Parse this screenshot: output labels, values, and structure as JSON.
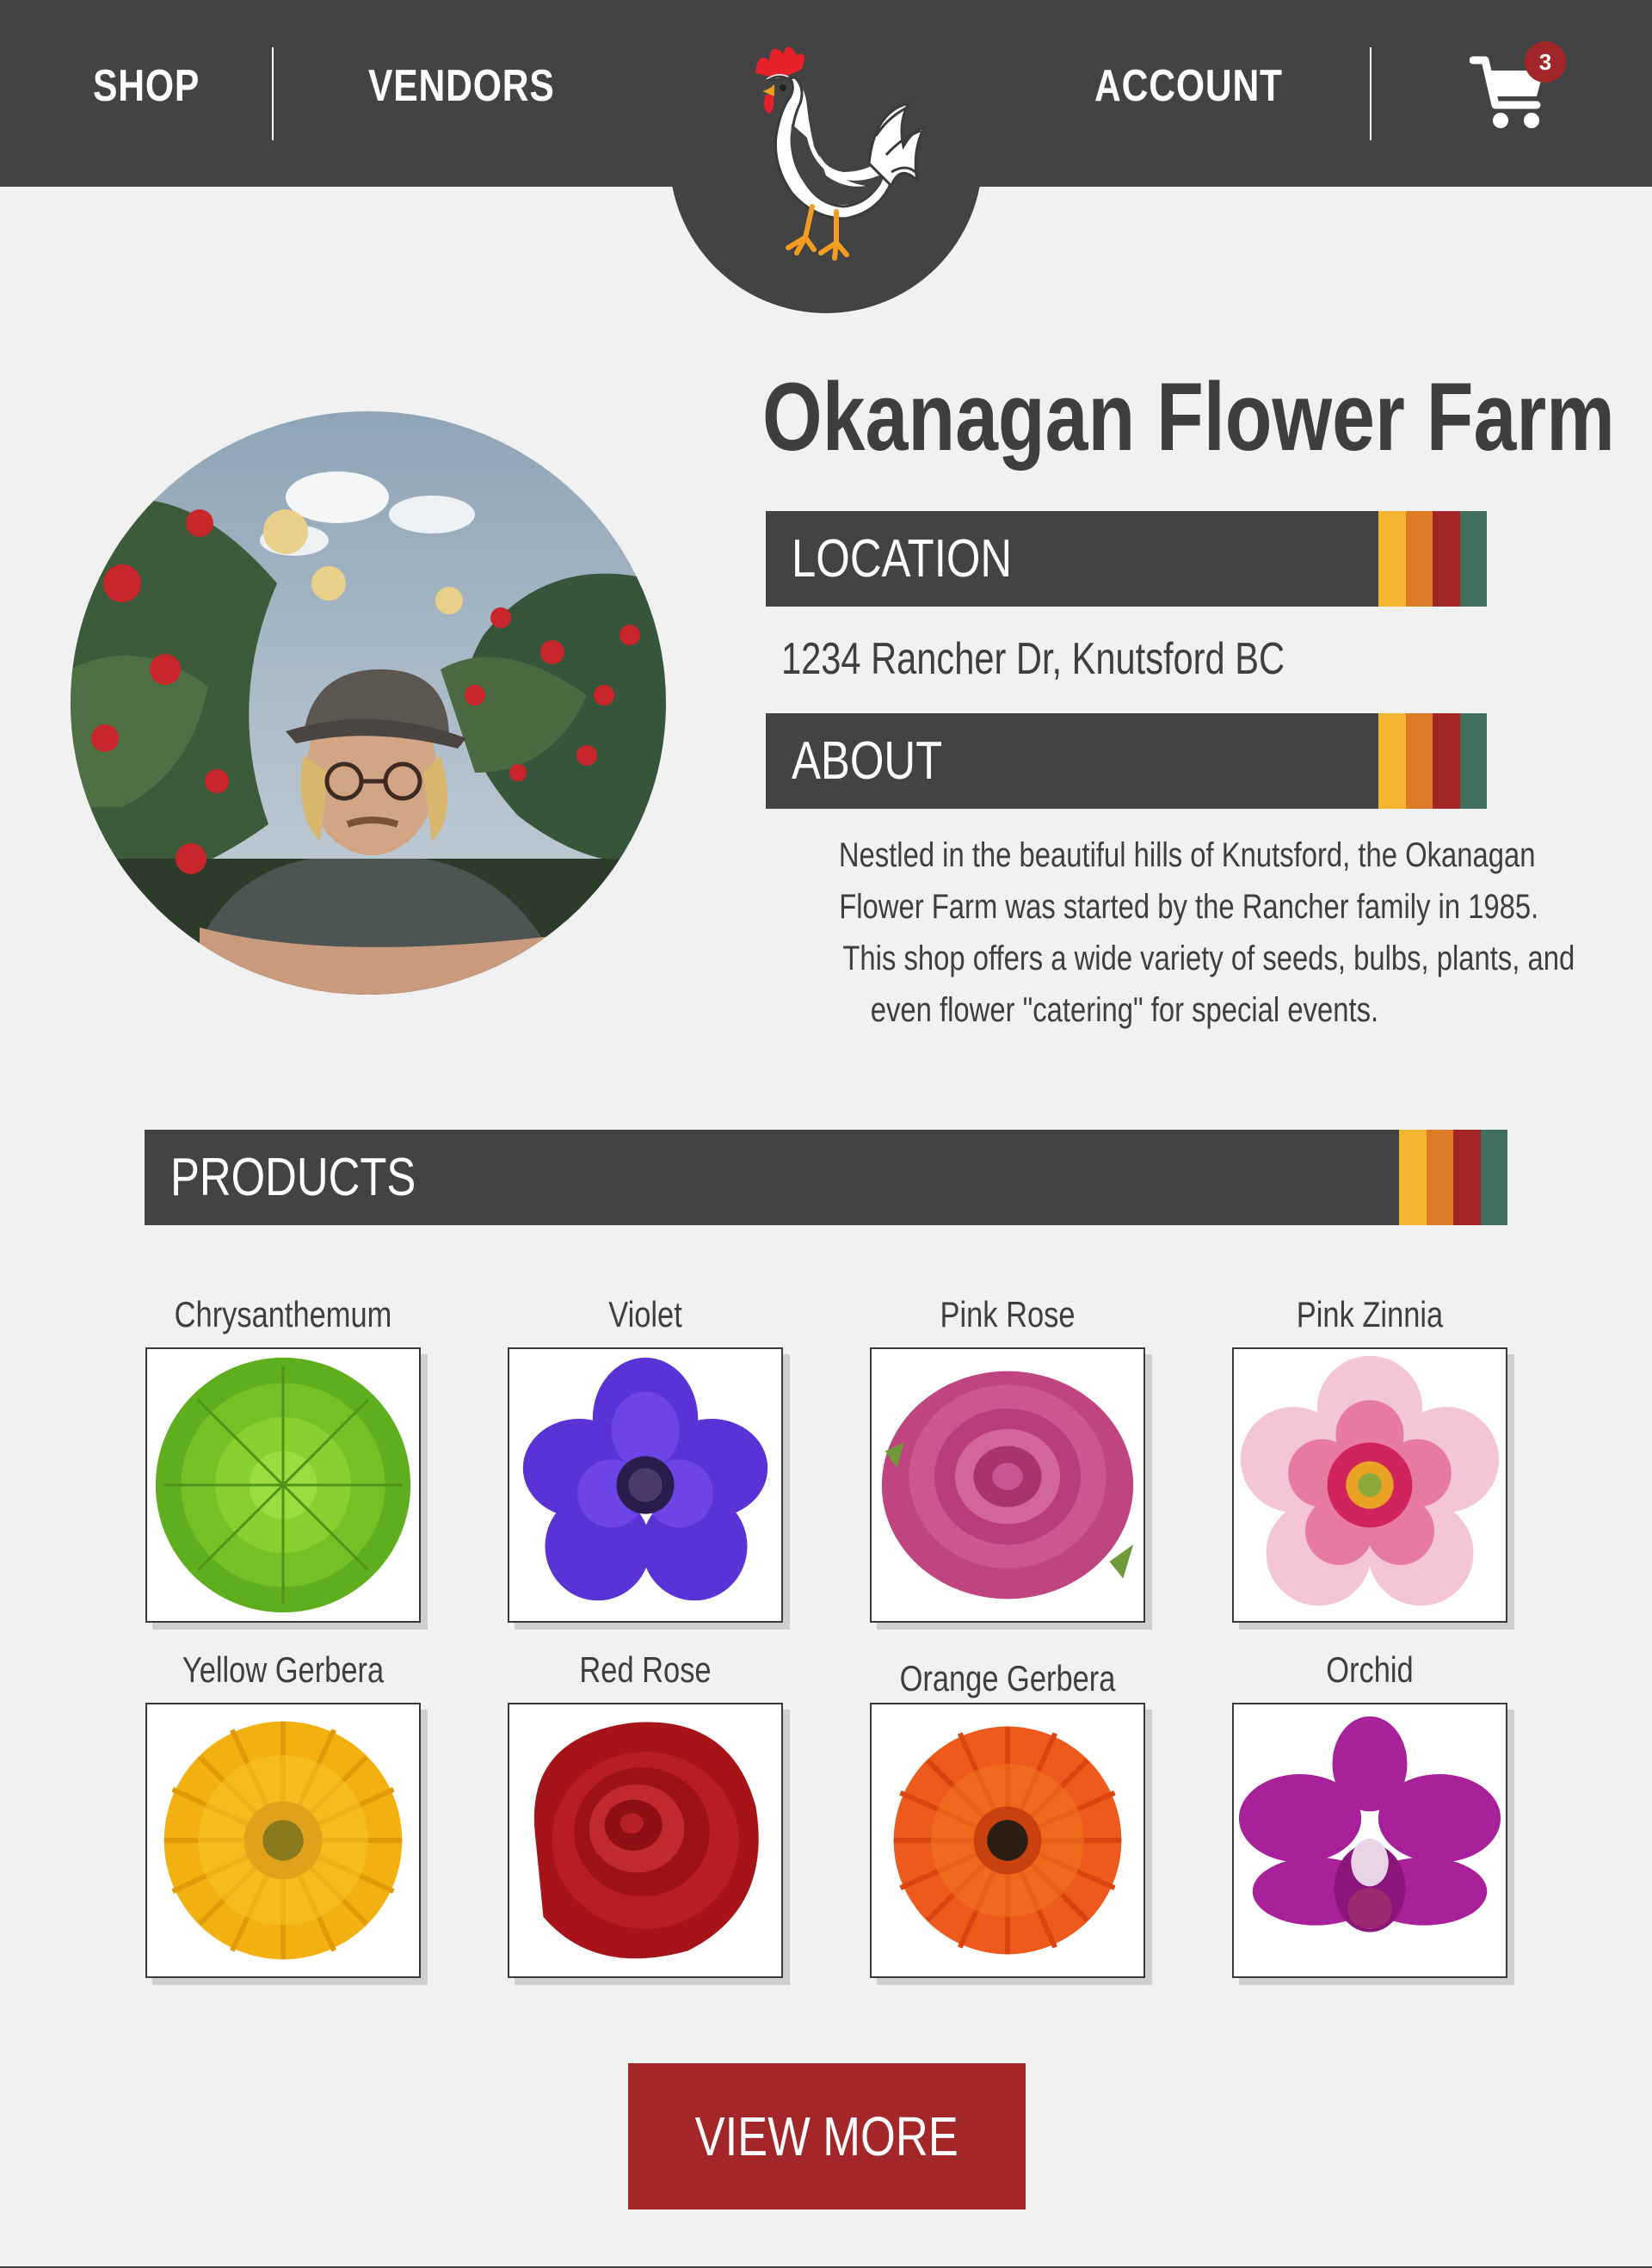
{
  "nav": {
    "shop_label": "SHOP",
    "vendors_label": "VENDORS",
    "account_label": "ACCOUNT",
    "cart_count": "3"
  },
  "vendor": {
    "name": "Okanagan Flower Farm",
    "location_heading": "LOCATION",
    "location": "1234 Rancher Dr, Knutsford BC",
    "about_heading": "ABOUT",
    "about_lines": [
      "Nestled in the beautiful hills of Knutsford, the Okanagan",
      "Flower Farm was started by the Rancher family in 1985.",
      "This shop offers a wide variety of seeds, bulbs, plants, and",
      "even flower \"catering\" for special events."
    ]
  },
  "products": {
    "heading": "PRODUCTS",
    "items": [
      {
        "name": "Chrysanthemum"
      },
      {
        "name": "Violet"
      },
      {
        "name": "Pink Rose"
      },
      {
        "name": "Pink Zinnia"
      },
      {
        "name": "Yellow Gerbera"
      },
      {
        "name": "Red Rose"
      },
      {
        "name": "Orange Gerbera"
      },
      {
        "name": "Orchid"
      }
    ],
    "view_more_label": "VIEW MORE"
  },
  "colors": {
    "header_bg": "#434343",
    "page_bg": "#f1f1f1",
    "accent_red": "#a32628",
    "stripe_colors": [
      "#f6b530",
      "#dc7a26",
      "#a32628",
      "#41715e"
    ]
  },
  "icons": {
    "logo": "rooster-icon",
    "cart": "shopping-cart-icon"
  }
}
